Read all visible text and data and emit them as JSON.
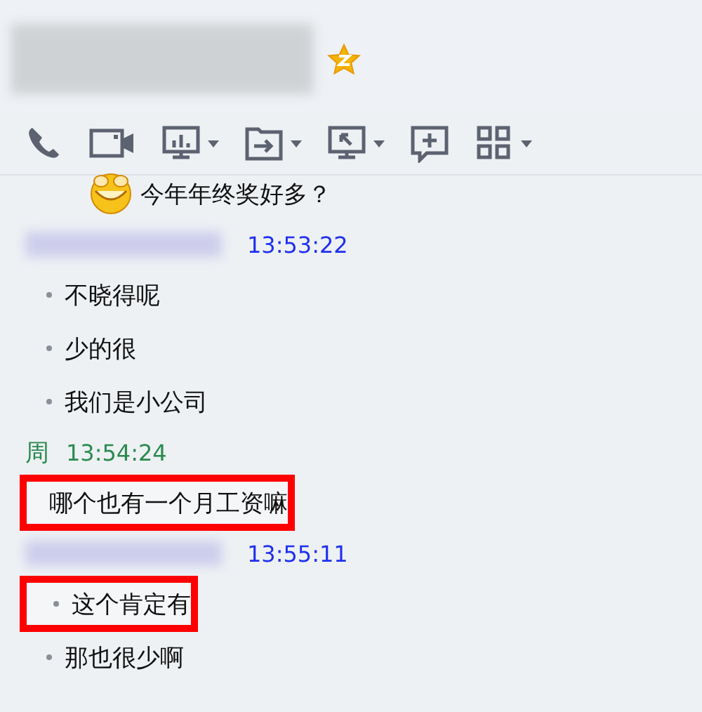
{
  "contact": {
    "name_blurred": true,
    "vip_badge": true
  },
  "toolbar": [
    {
      "kind": "phone",
      "dropdown": false
    },
    {
      "kind": "video",
      "dropdown": false
    },
    {
      "kind": "monitor",
      "dropdown": true
    },
    {
      "kind": "folder",
      "dropdown": true
    },
    {
      "kind": "share",
      "dropdown": true
    },
    {
      "kind": "comment",
      "dropdown": false
    },
    {
      "kind": "grid",
      "dropdown": true
    }
  ],
  "messages": [
    {
      "kind": "text",
      "emoji": true,
      "bullet": false,
      "highlighted": false,
      "text": "今年年终奖好多？"
    },
    {
      "kind": "header",
      "sender_blurred": true,
      "self": false,
      "time": "13:53:22"
    },
    {
      "kind": "text",
      "emoji": false,
      "bullet": true,
      "highlighted": false,
      "text": "不晓得呢"
    },
    {
      "kind": "text",
      "emoji": false,
      "bullet": true,
      "highlighted": false,
      "text": "少的很"
    },
    {
      "kind": "text",
      "emoji": false,
      "bullet": true,
      "highlighted": false,
      "text": "我们是小公司"
    },
    {
      "kind": "header",
      "sender_blurred": false,
      "sender": "周",
      "self": true,
      "time": "13:54:24"
    },
    {
      "kind": "text",
      "emoji": false,
      "bullet": false,
      "highlighted": true,
      "text": "哪个也有一个月工资嘛"
    },
    {
      "kind": "header",
      "sender_blurred": true,
      "self": false,
      "time": "13:55:11"
    },
    {
      "kind": "text",
      "emoji": false,
      "bullet": true,
      "highlighted": true,
      "text": "这个肯定有"
    },
    {
      "kind": "text",
      "emoji": false,
      "bullet": true,
      "highlighted": false,
      "text": "那也很少啊"
    }
  ]
}
